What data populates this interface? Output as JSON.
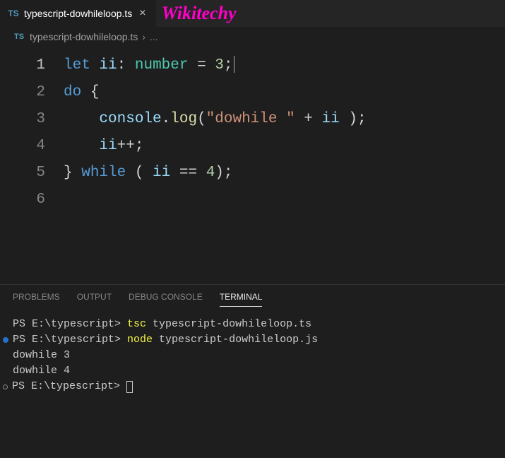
{
  "tab": {
    "icon_label": "TS",
    "filename": "typescript-dowhileloop.ts",
    "close": "×"
  },
  "watermark": "Wikitechy",
  "breadcrumb": {
    "icon_label": "TS",
    "file": "typescript-dowhileloop.ts",
    "sep": "›",
    "dots": "..."
  },
  "code": {
    "lines": [
      {
        "n": "1",
        "indent": "",
        "tokens": [
          {
            "t": "let ",
            "c": "tk-key"
          },
          {
            "t": "ii",
            "c": "tk-obj"
          },
          {
            "t": ": ",
            "c": "tk-pun"
          },
          {
            "t": "number",
            "c": "tk-type"
          },
          {
            "t": " = ",
            "c": "tk-op"
          },
          {
            "t": "3",
            "c": "tk-num"
          },
          {
            "t": ";",
            "c": "tk-pun"
          }
        ],
        "cursor": true,
        "active": true
      },
      {
        "n": "2",
        "indent": "",
        "tokens": [
          {
            "t": "do",
            "c": "tk-key"
          },
          {
            "t": " {",
            "c": "tk-pun"
          }
        ]
      },
      {
        "n": "3",
        "indent": "    ",
        "tokens": [
          {
            "t": "console",
            "c": "tk-obj"
          },
          {
            "t": ".",
            "c": "tk-pun"
          },
          {
            "t": "log",
            "c": "tk-fn"
          },
          {
            "t": "(",
            "c": "tk-pun"
          },
          {
            "t": "\"dowhile \"",
            "c": "tk-str"
          },
          {
            "t": " + ",
            "c": "tk-op"
          },
          {
            "t": "ii",
            "c": "tk-obj"
          },
          {
            "t": " );",
            "c": "tk-pun"
          }
        ]
      },
      {
        "n": "4",
        "indent": "    ",
        "tokens": [
          {
            "t": "ii",
            "c": "tk-obj"
          },
          {
            "t": "++;",
            "c": "tk-pun"
          }
        ]
      },
      {
        "n": "5",
        "indent": "",
        "tokens": [
          {
            "t": "} ",
            "c": "tk-pun"
          },
          {
            "t": "while",
            "c": "tk-key"
          },
          {
            "t": " ( ",
            "c": "tk-pun"
          },
          {
            "t": "ii",
            "c": "tk-obj"
          },
          {
            "t": " == ",
            "c": "tk-op"
          },
          {
            "t": "4",
            "c": "tk-num"
          },
          {
            "t": ");",
            "c": "tk-pun"
          }
        ]
      },
      {
        "n": "6",
        "indent": "",
        "tokens": []
      }
    ]
  },
  "panel": {
    "tabs": {
      "problems": "PROBLEMS",
      "output": "OUTPUT",
      "debug": "DEBUG CONSOLE",
      "terminal": "TERMINAL"
    }
  },
  "terminal": {
    "lines": [
      {
        "dot": "",
        "segs": [
          {
            "t": "PS E:\\typescript> ",
            "c": "t-ps"
          },
          {
            "t": "tsc ",
            "c": "t-cmd"
          },
          {
            "t": "typescript-dowhileloop.ts",
            "c": "t-ps"
          }
        ]
      },
      {
        "dot": "blue",
        "segs": [
          {
            "t": "PS E:\\typescript> ",
            "c": "t-ps"
          },
          {
            "t": "node ",
            "c": "t-cmd"
          },
          {
            "t": "typescript-dowhileloop.js",
            "c": "t-ps"
          }
        ]
      },
      {
        "dot": "",
        "segs": [
          {
            "t": "dowhile 3",
            "c": "t-ps"
          }
        ]
      },
      {
        "dot": "",
        "segs": [
          {
            "t": "dowhile 4",
            "c": "t-ps"
          }
        ]
      },
      {
        "dot": "grey",
        "segs": [
          {
            "t": "PS E:\\typescript> ",
            "c": "t-ps"
          }
        ],
        "cursor": true
      }
    ]
  }
}
